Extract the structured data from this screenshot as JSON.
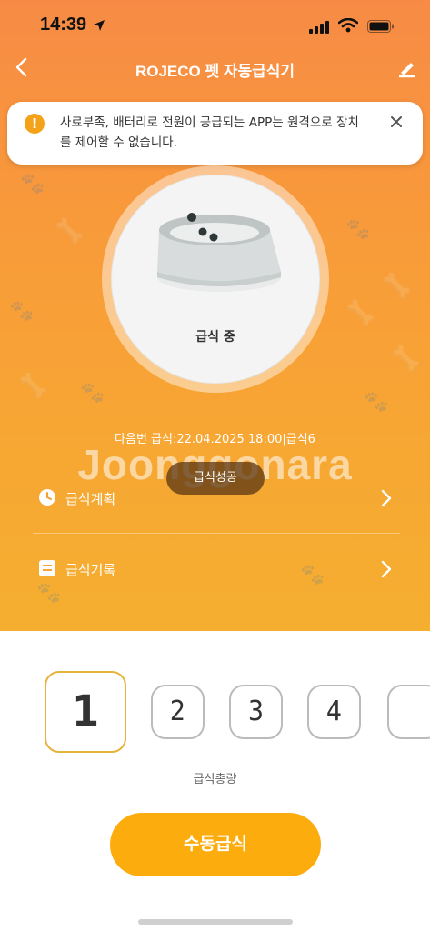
{
  "status_bar": {
    "time": "14:39"
  },
  "header": {
    "title": "ROJECO 펫 자동급식기"
  },
  "alert": {
    "message": "사료부족, 배터리로 전원이 공급되는 APP는 원격으로 장치를 제어할 수 없습니다."
  },
  "feeder": {
    "status": "급식 중"
  },
  "next_feeding": "다음번 급식:22.04.2025 18:00|급식6",
  "watermark": "Joonggonara",
  "toast": "급식성공",
  "menu": [
    {
      "label": "급식계획",
      "icon": "clock-icon"
    },
    {
      "label": "급식기록",
      "icon": "list-icon"
    }
  ],
  "portions": {
    "options": [
      "1",
      "2",
      "3",
      "4"
    ],
    "selected": "1",
    "label": "급식총량"
  },
  "manual_button": "수동급식",
  "colors": {
    "accent": "#fcac0c",
    "header_top": "#f78b45",
    "header_bottom": "#f5ae30",
    "selected_border": "#e8b33c"
  }
}
